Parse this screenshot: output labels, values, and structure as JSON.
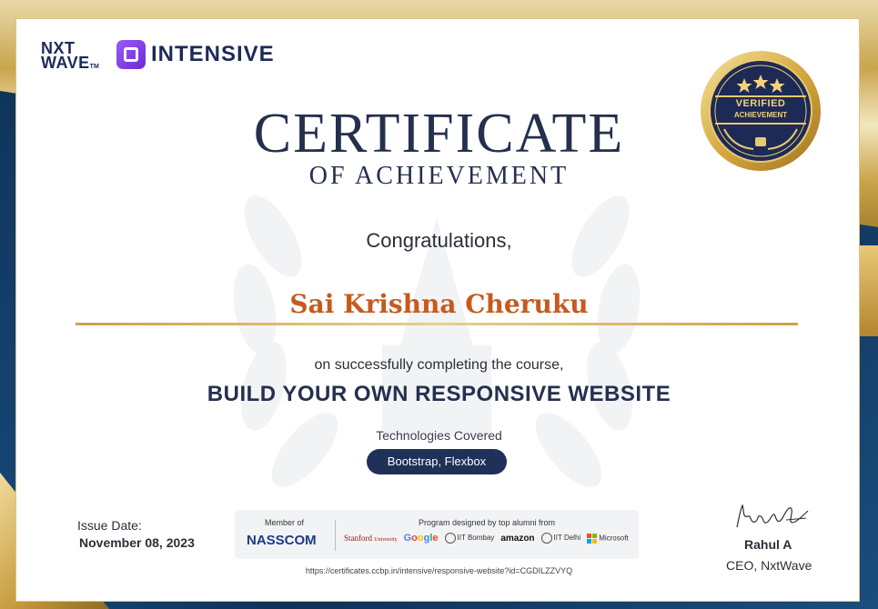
{
  "branding": {
    "nxtwave_line1": "NXT",
    "nxtwave_line2": "WAVE",
    "nxtwave_tm": "TM",
    "program_name": "INTENSIVE"
  },
  "badge": {
    "line1": "VERIFIED",
    "line2": "ACHIEVEMENT",
    "stars": 3
  },
  "certificate": {
    "title": "CERTIFICATE",
    "subtitle": "OF ACHIEVEMENT",
    "greeting": "Congratulations,",
    "recipient": "Sai Krishna Cheruku",
    "completion_text": "on successfully completing the course,",
    "course_name": "BUILD YOUR OWN RESPONSIVE WEBSITE",
    "technologies_label": "Technologies Covered",
    "technologies": "Bootstrap, Flexbox"
  },
  "issue": {
    "label": "Issue Date:",
    "date": "November 08, 2023"
  },
  "partners": {
    "member_label": "Member of",
    "member_org": "NASSCOM",
    "program_label": "Program designed by top alumni from",
    "institutions": [
      "Stanford",
      "University",
      "Google",
      "IIT Bombay",
      "amazon",
      "IIT Delhi",
      "Microsoft"
    ]
  },
  "verification_url": "https://certificates.ccbp.in/intensive/responsive-website?id=CGDILZZVYQ",
  "signatory": {
    "name": "Rahul A",
    "title": "CEO, NxtWave"
  },
  "colors": {
    "navy": "#25304f",
    "accent_orange": "#c65a1e",
    "gold": "#c9a24c",
    "pill_bg": "#1f3159",
    "frame_blue": "#123a5e"
  }
}
